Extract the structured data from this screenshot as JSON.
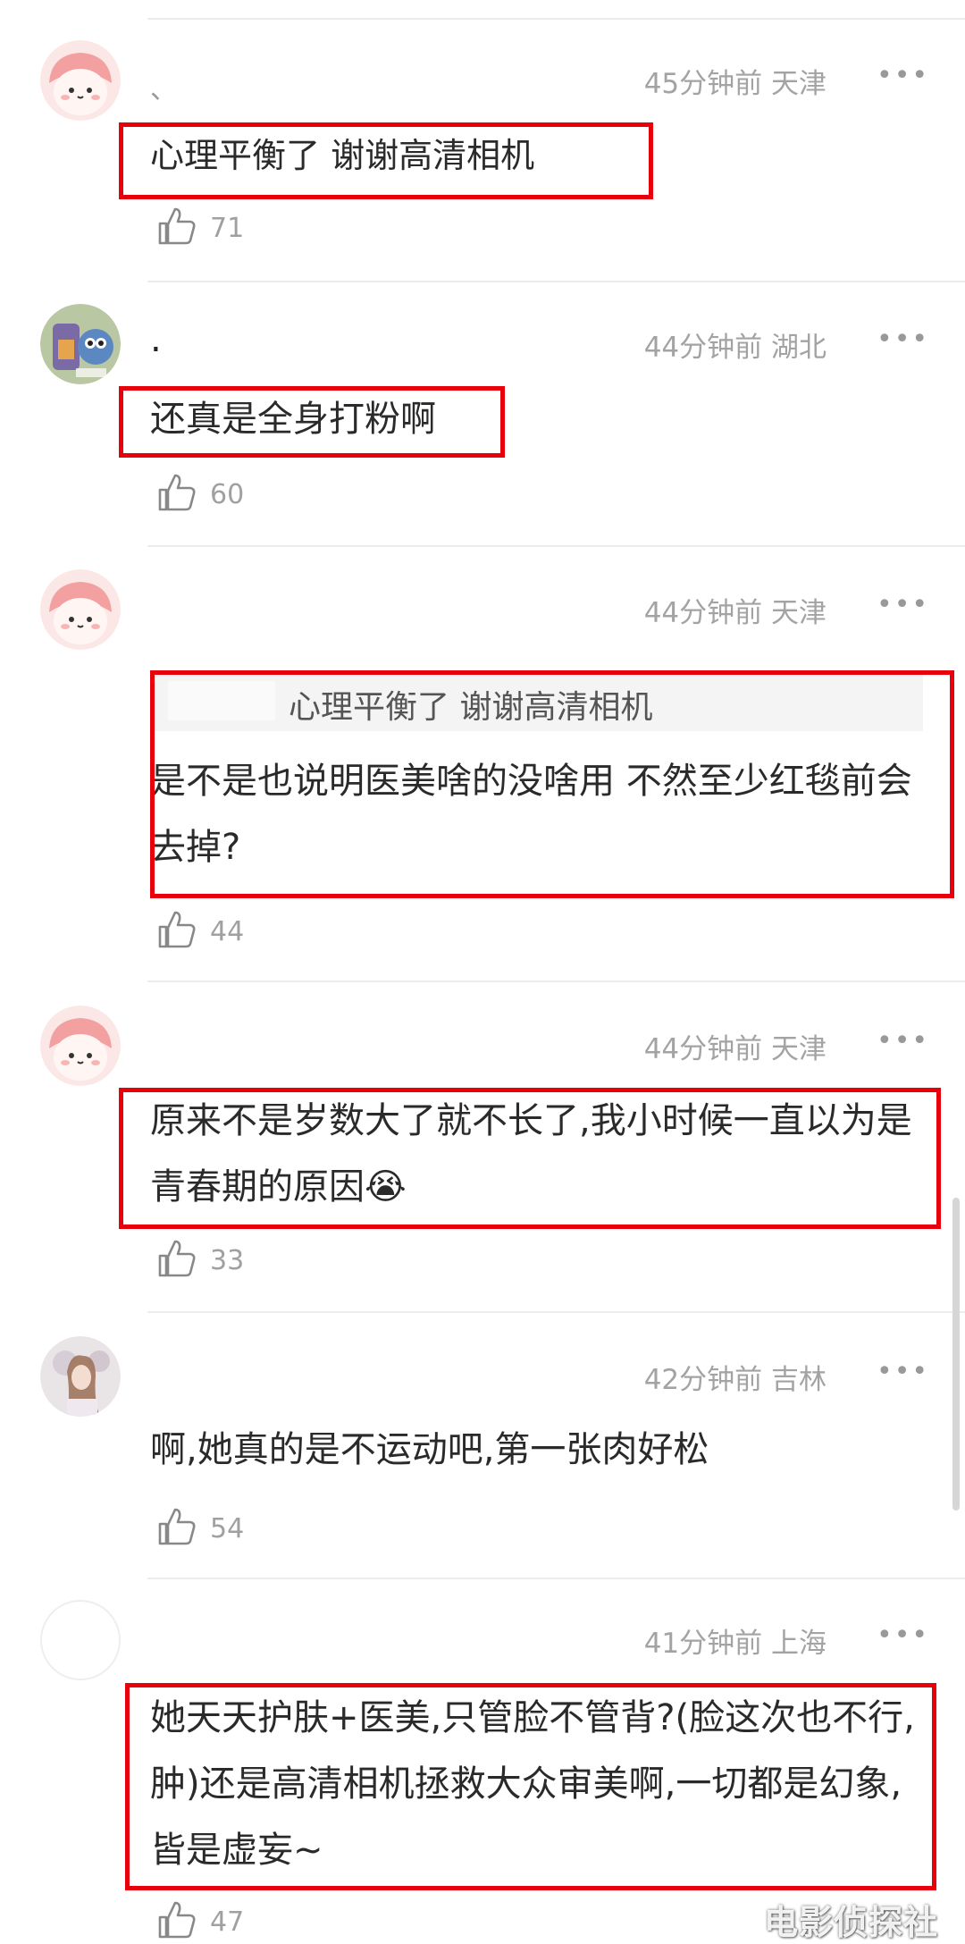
{
  "comments": [
    {
      "nickname": "、",
      "time": "45分钟前",
      "location": "天津",
      "text": "心理平衡了 谢谢高清相机",
      "likes": "71",
      "avatar": "pink-face"
    },
    {
      "nickname": ".",
      "time": "44分钟前",
      "location": "湖北",
      "text": "还真是全身打粉啊",
      "likes": "60",
      "avatar": "cartoon"
    },
    {
      "nickname": "",
      "time": "44分钟前",
      "location": "天津",
      "quote": "心理平衡了 谢谢高清相机",
      "text": "是不是也说明医美啥的没啥用 不然至少红毯前会去掉?",
      "likes": "44",
      "avatar": "pink-face"
    },
    {
      "nickname": "",
      "time": "44分钟前",
      "location": "天津",
      "text": "原来不是岁数大了就不长了,我小时候一直以为是青春期的原因😭",
      "likes": "33",
      "avatar": "pink-face"
    },
    {
      "nickname": "",
      "time": "42分钟前",
      "location": "吉林",
      "text": "啊,她真的是不运动吧,第一张肉好松",
      "likes": "54",
      "avatar": "photo"
    },
    {
      "nickname": "",
      "time": "41分钟前",
      "location": "上海",
      "text": "她天天护肤+医美,只管脸不管背?(脸这次也不行,肿)还是高清相机拯救大众审美啊,一切都是幻象,皆是虚妄~",
      "likes": "47",
      "avatar": "blank"
    }
  ],
  "more_glyph": "•••",
  "watermark": "电影侦探社",
  "colors": {
    "highlight_border": "#e8000b",
    "meta_text": "#a3a3a3",
    "body_text": "#2a2a2a"
  }
}
